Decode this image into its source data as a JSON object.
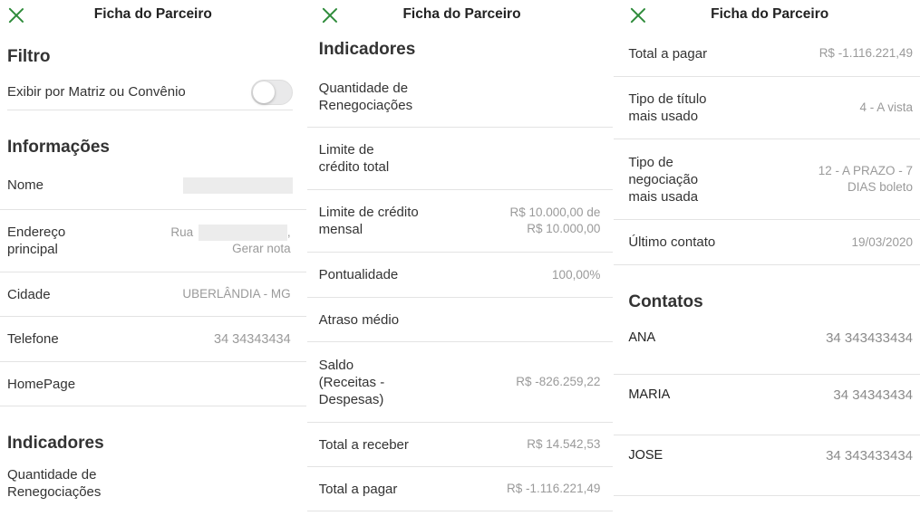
{
  "header": {
    "title": "Ficha do Parceiro"
  },
  "screen1": {
    "filtro": {
      "heading": "Filtro",
      "toggle_label": "Exibir por Matriz ou Convênio",
      "toggle_on": false
    },
    "informacoes": {
      "heading": "Informações",
      "nome_label": "Nome",
      "endereco_label": "Endereço principal",
      "endereco_prefix": "Rua",
      "endereco_suffix": ",",
      "gerar_nota": "Gerar nota",
      "cidade_label": "Cidade",
      "cidade_value": "UBERLÂNDIA - MG",
      "telefone_label": "Telefone",
      "telefone_value": "34  34343434",
      "homepage_label": "HomePage"
    },
    "indicadores": {
      "heading": "Indicadores",
      "renegociacoes_label": "Quantidade de Renegociações"
    }
  },
  "screen2": {
    "heading": "Indicadores",
    "rows": [
      {
        "label": "Quantidade de Renegociações",
        "value": ""
      },
      {
        "label": "Limite de crédito total",
        "value": ""
      },
      {
        "label": "Limite de crédito mensal",
        "value": "R$ 10.000,00 de R$ 10.000,00"
      },
      {
        "label": "Pontualidade",
        "value": "100,00%"
      },
      {
        "label": "Atraso médio",
        "value": ""
      },
      {
        "label": "Saldo (Receitas - Despesas)",
        "value": "R$ -826.259,22"
      },
      {
        "label": "Total a receber",
        "value": "R$ 14.542,53"
      },
      {
        "label": "Total a pagar",
        "value": "R$ -1.116.221,49"
      }
    ]
  },
  "screen3": {
    "rows": [
      {
        "label": "Total a pagar",
        "value": "R$ -1.116.221,49"
      },
      {
        "label": "Tipo de título mais usado",
        "value": "4 - A vista"
      },
      {
        "label": "Tipo de negociação mais usada",
        "value": "12 - A PRAZO - 7 DIAS boleto"
      },
      {
        "label": "Último contato",
        "value": "19/03/2020"
      }
    ],
    "contatos": {
      "heading": "Contatos",
      "items": [
        {
          "name": "ANA",
          "phone": "34  343433434"
        },
        {
          "name": "MARIA",
          "phone": "34  34343434"
        },
        {
          "name": "JOSE",
          "phone": "34  343433434"
        }
      ]
    }
  },
  "colors": {
    "accent": "#2e8b3a",
    "divider": "#e3e3e3",
    "value_text": "#9a9a9a"
  }
}
